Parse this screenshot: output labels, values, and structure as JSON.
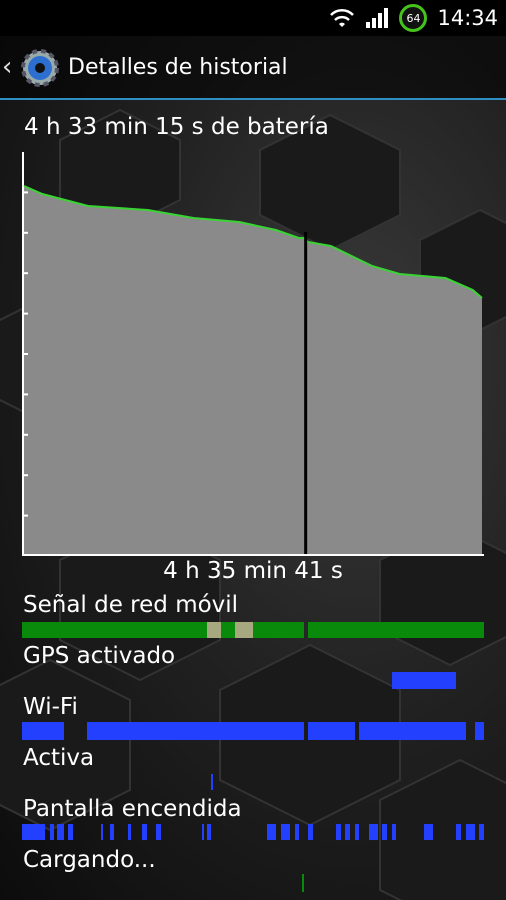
{
  "status_bar": {
    "time": "14:34",
    "battery_level": "64"
  },
  "action_bar": {
    "title": "Detalles de historial"
  },
  "battery_duration": "4 h 33 min 15 s de batería",
  "chart_data": {
    "type": "area",
    "title": "4 h 33 min 15 s de batería",
    "xlabel": "4 h 35 min 41 s",
    "ylabel": "",
    "ylim": [
      0,
      100
    ],
    "x_fraction": [
      0,
      0.04,
      0.14,
      0.27,
      0.37,
      0.47,
      0.55,
      0.6,
      0.61,
      0.62,
      0.67,
      0.76,
      0.82,
      0.92,
      0.98,
      1
    ],
    "y_percent": [
      92,
      90,
      87,
      86,
      84,
      83,
      81,
      79,
      79,
      78,
      77,
      72,
      70,
      69,
      66,
      64
    ],
    "colors": {
      "fill": "#8a8a8a",
      "line": "#39d434",
      "axis": "#ffffff",
      "gap": "#000000"
    },
    "gap_at_fraction": 0.615
  },
  "chart_duration": "4 h 35 min 41 s",
  "rows": [
    {
      "label": "Señal de red móvil",
      "color": "#0a8a0a"
    },
    {
      "label": "GPS activado",
      "color": "#2440ff"
    },
    {
      "label": "Wi-Fi",
      "color": "#2440ff"
    },
    {
      "label": "Activa",
      "color": "#2440ff"
    },
    {
      "label": "Pantalla encendida",
      "color": "#2440ff"
    },
    {
      "label": "Cargando...",
      "color": "#0a8a0a"
    }
  ],
  "tracks": {
    "signal": [
      [
        0,
        0.23,
        "#0a8a0a"
      ],
      [
        0.23,
        0.4,
        "#0a8a0a"
      ],
      [
        0.4,
        0.43,
        "#a8a880"
      ],
      [
        0.43,
        0.46,
        "#0a8a0a"
      ],
      [
        0.46,
        0.5,
        "#a8a880"
      ],
      [
        0.5,
        0.61,
        "#0a8a0a"
      ],
      [
        0.62,
        1,
        "#0a8a0a"
      ]
    ],
    "gps": [
      [
        0.8,
        0.94
      ]
    ],
    "wifi": [
      [
        0,
        0.09
      ],
      [
        0.14,
        0.61
      ],
      [
        0.62,
        0.72
      ],
      [
        0.73,
        0.96
      ],
      [
        0.98,
        1
      ]
    ],
    "active": [
      [
        0.41,
        0.415
      ]
    ],
    "screen": [
      [
        0,
        0.05
      ],
      [
        0.06,
        0.07
      ],
      [
        0.075,
        0.09
      ],
      [
        0.1,
        0.11
      ],
      [
        0.17,
        0.175
      ],
      [
        0.19,
        0.2
      ],
      [
        0.23,
        0.235
      ],
      [
        0.26,
        0.27
      ],
      [
        0.29,
        0.3
      ],
      [
        0.39,
        0.395
      ],
      [
        0.4,
        0.41
      ],
      [
        0.53,
        0.55
      ],
      [
        0.56,
        0.58
      ],
      [
        0.59,
        0.6
      ],
      [
        0.62,
        0.63
      ],
      [
        0.68,
        0.69
      ],
      [
        0.7,
        0.71
      ],
      [
        0.72,
        0.73
      ],
      [
        0.75,
        0.77
      ],
      [
        0.78,
        0.79
      ],
      [
        0.8,
        0.81
      ],
      [
        0.87,
        0.89
      ],
      [
        0.94,
        0.95
      ],
      [
        0.96,
        0.98
      ],
      [
        0.99,
        1
      ]
    ],
    "charging": [
      [
        0.605,
        0.61
      ]
    ]
  }
}
